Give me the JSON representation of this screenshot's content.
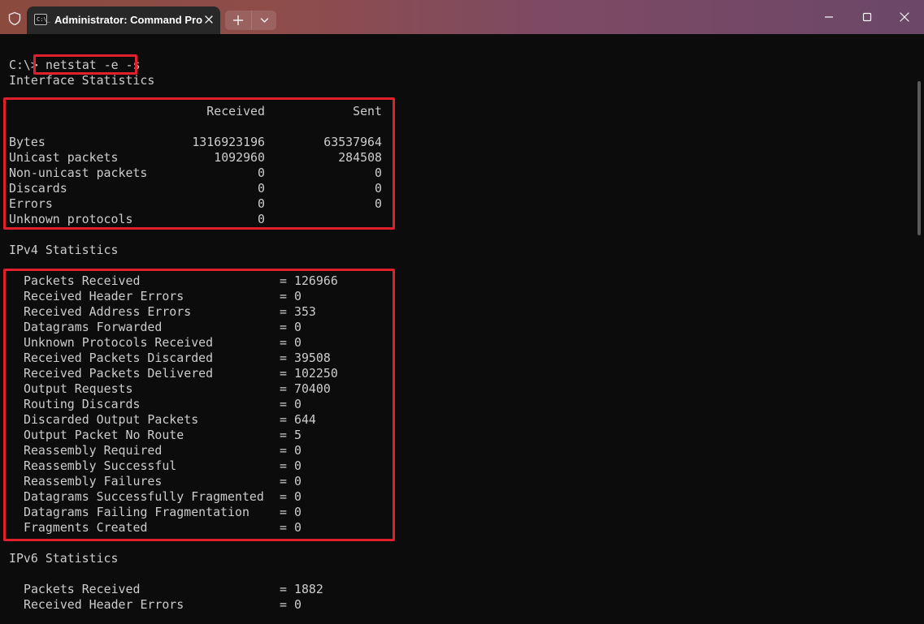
{
  "window": {
    "tab_title": "Administrator: Command Pro",
    "tab_icon_text": "C:\\_",
    "icons": [
      "shield-icon",
      "cmd-icon",
      "close-icon",
      "plus-icon",
      "chevron-down-icon",
      "minimize-icon",
      "maximize-icon",
      "close-icon"
    ]
  },
  "terminal": {
    "prompt": "C:\\>",
    "command": "netstat -e -s",
    "interface": {
      "heading": "Interface Statistics",
      "col_received": "Received",
      "col_sent": "Sent",
      "rows": [
        {
          "label": "Bytes",
          "received": "1316923196",
          "sent": "63537964"
        },
        {
          "label": "Unicast packets",
          "received": "1092960",
          "sent": "284508"
        },
        {
          "label": "Non-unicast packets",
          "received": "0",
          "sent": "0"
        },
        {
          "label": "Discards",
          "received": "0",
          "sent": "0"
        },
        {
          "label": "Errors",
          "received": "0",
          "sent": "0"
        },
        {
          "label": "Unknown protocols",
          "received": "0",
          "sent": ""
        }
      ]
    },
    "ipv4": {
      "heading": "IPv4 Statistics",
      "rows": [
        {
          "label": "Packets Received",
          "value": "126966"
        },
        {
          "label": "Received Header Errors",
          "value": "0"
        },
        {
          "label": "Received Address Errors",
          "value": "353"
        },
        {
          "label": "Datagrams Forwarded",
          "value": "0"
        },
        {
          "label": "Unknown Protocols Received",
          "value": "0"
        },
        {
          "label": "Received Packets Discarded",
          "value": "39508"
        },
        {
          "label": "Received Packets Delivered",
          "value": "102250"
        },
        {
          "label": "Output Requests",
          "value": "70400"
        },
        {
          "label": "Routing Discards",
          "value": "0"
        },
        {
          "label": "Discarded Output Packets",
          "value": "644"
        },
        {
          "label": "Output Packet No Route",
          "value": "5"
        },
        {
          "label": "Reassembly Required",
          "value": "0"
        },
        {
          "label": "Reassembly Successful",
          "value": "0"
        },
        {
          "label": "Reassembly Failures",
          "value": "0"
        },
        {
          "label": "Datagrams Successfully Fragmented",
          "value": "0"
        },
        {
          "label": "Datagrams Failing Fragmentation",
          "value": "0"
        },
        {
          "label": "Fragments Created",
          "value": "0"
        }
      ]
    },
    "ipv6": {
      "heading": "IPv6 Statistics",
      "rows": [
        {
          "label": "Packets Received",
          "value": "1882"
        },
        {
          "label": "Received Header Errors",
          "value": "0"
        }
      ]
    },
    "equals": "= "
  },
  "colors": {
    "terminal_bg": "#0c0c0c",
    "terminal_fg": "#cccccc",
    "highlight": "#e0202a",
    "tab_bg": "#282828"
  }
}
